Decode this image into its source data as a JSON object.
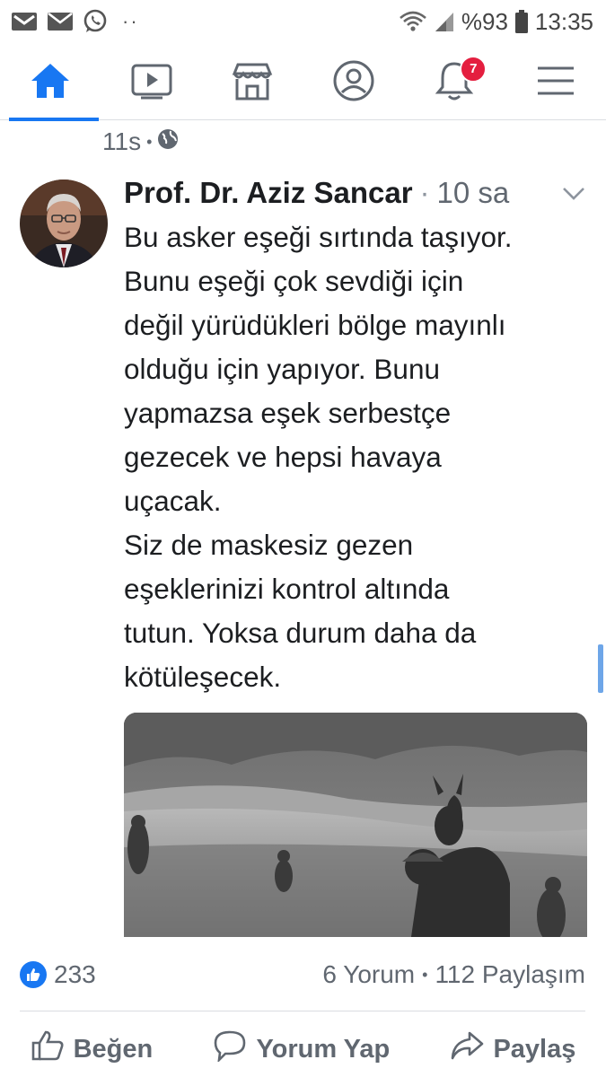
{
  "status_bar": {
    "battery_percent": "%93",
    "time": "13:35",
    "left_icons": [
      "gmail-icon",
      "mail-icon",
      "whatsapp-icon"
    ],
    "more": "··"
  },
  "nav": {
    "items": [
      {
        "name": "home",
        "icon": "home-icon",
        "active": true
      },
      {
        "name": "watch",
        "icon": "video-icon",
        "active": false
      },
      {
        "name": "marketplace",
        "icon": "store-icon",
        "active": false
      },
      {
        "name": "profile",
        "icon": "user-icon",
        "active": false
      },
      {
        "name": "notifications",
        "icon": "bell-icon",
        "active": false,
        "badge": "7"
      },
      {
        "name": "menu",
        "icon": "hamburger-icon",
        "active": false
      }
    ],
    "accent": "#1877f2",
    "badge_color": "#e41e3f"
  },
  "post": {
    "time": "11s",
    "dot": "•",
    "privacy_icon": "globe-icon"
  },
  "comment": {
    "author": "Prof. Dr. Aziz Sancar",
    "separator": "·",
    "time": "10 sa",
    "lines": [
      "Bu asker eşeği sırtında taşıyor.",
      "Bunu eşeği çok sevdiği için",
      "değil yürüdükleri bölge mayınlı",
      "olduğu için yapıyor. Bunu",
      "yapmazsa eşek serbestçe",
      "gezecek ve hepsi havaya",
      "uçacak.",
      "Siz de maskesiz gezen",
      "eşeklerinizi kontrol altında",
      "tutun. Yoksa durum daha da",
      "kötüleşecek."
    ]
  },
  "reactions": {
    "like_count": "233",
    "comments": "6 Yorum",
    "dot": "•",
    "shares": "112 Paylaşım"
  },
  "actions": {
    "like": "Beğen",
    "comment": "Yorum Yap",
    "share": "Paylaş"
  }
}
